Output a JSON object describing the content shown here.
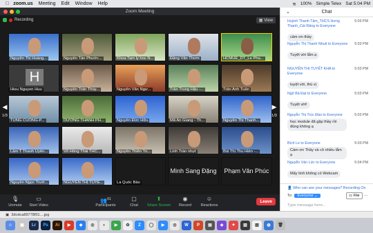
{
  "menubar": {
    "app": "zoom.us",
    "items": [
      "Meeting",
      "Edit",
      "Window",
      "Help"
    ],
    "battery": "100%",
    "input_source": "Simple Telex",
    "clock": "Sat 5:04 PM"
  },
  "window": {
    "title": "Zoom Meeting"
  },
  "video": {
    "recording": "Recording",
    "view": "View",
    "page_left": "1/3",
    "page_right": "1/3",
    "participants": [
      "Nguyễn Thị Hoàng...",
      "Nguyễn Tấn Phước...",
      "Khoa Tam ly hoc N...",
      "Đặng Văn Thơm",
      "HCMUE_DT_Le Pha...",
      "Hieu Nguyen Huu",
      "Nguyễn Trần Thùy...",
      "Nguyễn Văn Ngư...",
      "Trần Trung Hậu -...",
      "Trần Anh Tuấn",
      "TUNG CUONG-P...",
      "DƯƠNG THANH PH...",
      "Nguyễn Đức Hữu",
      "Mã An Giang - Th...",
      "Nguyễn Thị Thanh...",
      "Lâm T Thanh Uyên...",
      "Võ Hồng Thái THC...",
      "Nguyễn Thiên Tri...",
      "Linh Trần nhựt",
      "Bùi Thị Thu Hiền -...",
      "Nguyễn Ngọc Trưở...",
      "NGUYỄN THỊ TUYẾ...",
      "La Quốc Bảo",
      "Minh Sang Đặng",
      "Phạm Văn Phúc"
    ],
    "hieu_initial": "H"
  },
  "toolbar": {
    "unmute": "Unmute",
    "start_video": "Start Video",
    "participants": "Participants",
    "participants_count": "61",
    "chat": "Chat",
    "share": "Share Screen",
    "record": "Record",
    "reactions": "Reactions",
    "leave": "Leave"
  },
  "chat": {
    "title": "Chat",
    "messages": [
      {
        "from": "Huỳnh Thanh Tâm_THCS Hưng Thạnh_Cái Răng to Everyone",
        "time": "5:03 PM",
        "text": "cảm ơn thầy"
      },
      {
        "from": "Nguyễn Thị Thanh Nhuệ to Everyone",
        "time": "5:03 PM",
        "text": "Tuyệt vời lắm ạ"
      },
      {
        "from": "NGUYỄN THỊ TUYẾT KHA to Everyone",
        "time": "5:03 PM",
        "text": "tuyệt vời, thú vị"
      },
      {
        "from": "Ngô Bá Đạt to Everyone",
        "time": "5:03 PM",
        "text": "Tuyệt vời!"
      },
      {
        "from": "Nguyễn Thị Trúc Đào to Everyone",
        "time": "5:03 PM",
        "text": "học module đã gặp thầy rồi đúng không ạ"
      },
      {
        "from": "Bích Le to Everyone",
        "time": "5:03 PM",
        "text": "Cám ơn Thầy và cô nhiều lắm ạ"
      },
      {
        "from": "Nguyễn Văn Lức to Everyone",
        "time": "5:04 PM",
        "text": "Mấy tính không có Webcam"
      }
    ],
    "who_can_see": "Who can see your messages? Recording On",
    "to_label": "To:",
    "to_value": "Everyone",
    "file": "File",
    "placeholder": "Type message here..."
  },
  "download": {
    "filename": "3dcdca89778f01....jpg"
  },
  "dock": [
    "Lr",
    "Ps",
    "Ai"
  ]
}
